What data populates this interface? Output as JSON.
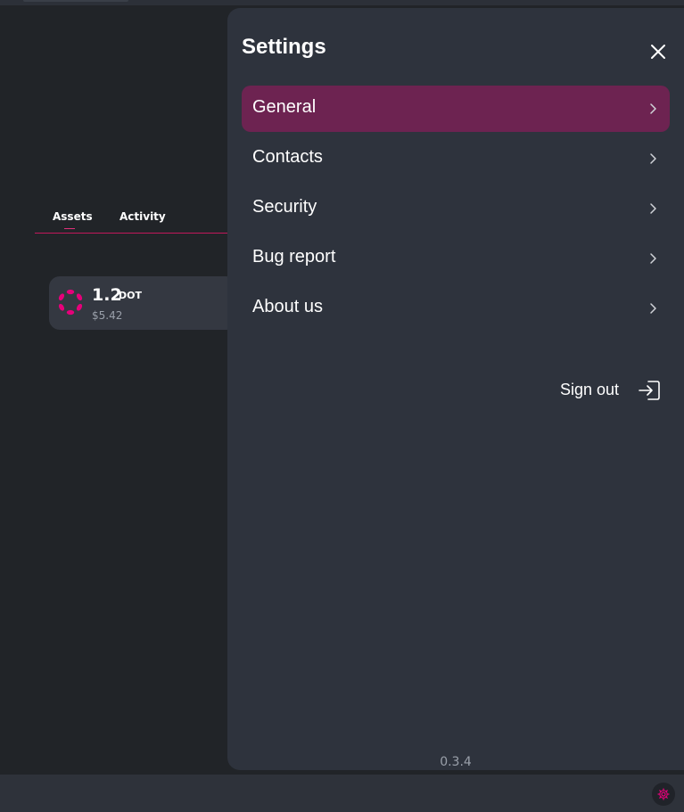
{
  "background": {
    "tabs": [
      {
        "label": "Assets"
      },
      {
        "label": "Activity"
      }
    ],
    "asset": {
      "amount": "1.2",
      "symbol": "DOT",
      "fiat_value": "$5.42",
      "logo_icon": "polkadot-logo-icon"
    }
  },
  "settings": {
    "title": "Settings",
    "close_icon": "close-icon",
    "menu": [
      {
        "label": "General",
        "active": true
      },
      {
        "label": "Contacts",
        "active": false
      },
      {
        "label": "Security",
        "active": false
      },
      {
        "label": "Bug report",
        "active": false
      },
      {
        "label": "About us",
        "active": false
      }
    ],
    "sign_out_label": "Sign out",
    "version": "0.3.4"
  },
  "bottom_bar": {
    "settings_icon": "gear-icon"
  },
  "colors": {
    "accent": "#e6007a",
    "active_item_bg": "#6d2351",
    "drawer_bg": "#2e333d",
    "page_bg": "#212428"
  }
}
